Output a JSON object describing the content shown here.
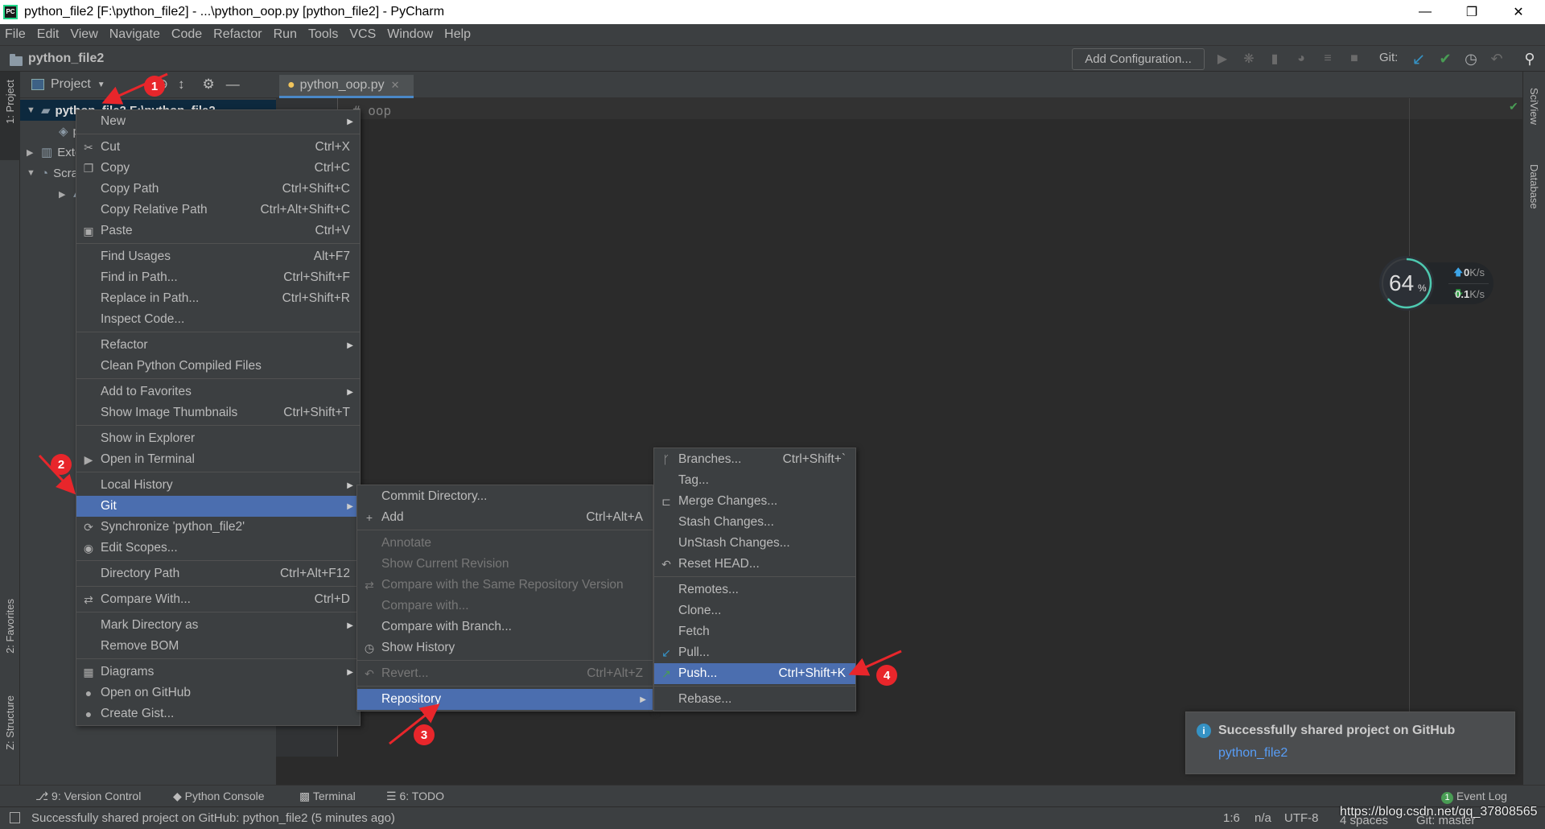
{
  "window": {
    "title": "python_file2 [F:\\python_file2] - ...\\python_oop.py [python_file2] - PyCharm",
    "logo": "PC"
  },
  "menubar": [
    "File",
    "Edit",
    "View",
    "Navigate",
    "Code",
    "Refactor",
    "Run",
    "Tools",
    "VCS",
    "Window",
    "Help"
  ],
  "navbar": {
    "project": "python_file2",
    "add_configuration": "Add Configuration...",
    "git_label": "Git:"
  },
  "left_strip": {
    "project": "1: Project",
    "favorites": "2: Favorites",
    "structure": "Z: Structure"
  },
  "right_strip": {
    "sciview": "SciView",
    "database": "Database"
  },
  "project_panel": {
    "title": "Project",
    "tree": [
      {
        "label": "python_file2  F:\\python_file2",
        "icon": "folder-icon",
        "expanded": true,
        "selected": true
      },
      {
        "label": "python_oop.py",
        "icon": "python-file-icon"
      },
      {
        "label": "External Libraries",
        "icon": "library-icon",
        "expanded": false
      },
      {
        "label": "Scratches and Consoles",
        "icon": "scratches-icon",
        "expanded": true
      },
      {
        "label": "Extensions",
        "icon": "folder-icon",
        "expanded": false
      }
    ]
  },
  "editor": {
    "tab": "python_oop.py",
    "code_line": "# oop"
  },
  "network_widget": {
    "cpu": "64",
    "cpu_unit": "%",
    "upload": "0",
    "download": "0.1",
    "unit": "K/s"
  },
  "context_menu": [
    {
      "label": "New",
      "submenu": true
    },
    {
      "sep": true
    },
    {
      "label": "Cut",
      "shortcut": "Ctrl+X",
      "icon": "cut-icon"
    },
    {
      "label": "Copy",
      "shortcut": "Ctrl+C",
      "icon": "copy-icon"
    },
    {
      "label": "Copy Path",
      "shortcut": "Ctrl+Shift+C"
    },
    {
      "label": "Copy Relative Path",
      "shortcut": "Ctrl+Alt+Shift+C"
    },
    {
      "label": "Paste",
      "shortcut": "Ctrl+V",
      "icon": "paste-icon"
    },
    {
      "sep": true
    },
    {
      "label": "Find Usages",
      "shortcut": "Alt+F7"
    },
    {
      "label": "Find in Path...",
      "shortcut": "Ctrl+Shift+F"
    },
    {
      "label": "Replace in Path...",
      "shortcut": "Ctrl+Shift+R"
    },
    {
      "label": "Inspect Code..."
    },
    {
      "sep": true
    },
    {
      "label": "Refactor",
      "submenu": true
    },
    {
      "label": "Clean Python Compiled Files"
    },
    {
      "sep": true
    },
    {
      "label": "Add to Favorites",
      "submenu": true
    },
    {
      "label": "Show Image Thumbnails",
      "shortcut": "Ctrl+Shift+T"
    },
    {
      "sep": true
    },
    {
      "label": "Show in Explorer"
    },
    {
      "label": "Open in Terminal",
      "icon": "terminal-icon"
    },
    {
      "sep": true
    },
    {
      "label": "Local History",
      "submenu": true
    },
    {
      "label": "Git",
      "submenu": true,
      "highlighted": true
    },
    {
      "label": "Synchronize 'python_file2'",
      "icon": "sync-icon"
    },
    {
      "label": "Edit Scopes...",
      "icon": "scopes-icon"
    },
    {
      "sep": true
    },
    {
      "label": "Directory Path",
      "shortcut": "Ctrl+Alt+F12"
    },
    {
      "sep": true
    },
    {
      "label": "Compare With...",
      "shortcut": "Ctrl+D",
      "icon": "compare-icon"
    },
    {
      "sep": true
    },
    {
      "label": "Mark Directory as",
      "submenu": true
    },
    {
      "label": "Remove BOM"
    },
    {
      "sep": true
    },
    {
      "label": "Diagrams",
      "submenu": true,
      "icon": "diagram-icon"
    },
    {
      "label": "Open on GitHub",
      "icon": "github-icon"
    },
    {
      "label": "Create Gist...",
      "icon": "github-icon"
    }
  ],
  "git_menu": [
    {
      "label": "Commit Directory..."
    },
    {
      "label": "Add",
      "shortcut": "Ctrl+Alt+A",
      "icon": "plus-icon"
    },
    {
      "sep": true
    },
    {
      "label": "Annotate",
      "disabled": true
    },
    {
      "label": "Show Current Revision",
      "disabled": true
    },
    {
      "label": "Compare with the Same Repository Version",
      "disabled": true,
      "icon": "compare-icon"
    },
    {
      "label": "Compare with...",
      "disabled": true
    },
    {
      "label": "Compare with Branch..."
    },
    {
      "label": "Show History",
      "icon": "clock-icon"
    },
    {
      "sep": true
    },
    {
      "label": "Revert...",
      "shortcut": "Ctrl+Alt+Z",
      "disabled": true,
      "icon": "revert-icon"
    },
    {
      "sep": true
    },
    {
      "label": "Repository",
      "submenu": true,
      "highlighted": true
    }
  ],
  "repository_menu": [
    {
      "label": "Branches...",
      "shortcut": "Ctrl+Shift+`",
      "icon": "branch-icon"
    },
    {
      "label": "Tag..."
    },
    {
      "label": "Merge Changes...",
      "icon": "merge-icon"
    },
    {
      "label": "Stash Changes..."
    },
    {
      "label": "UnStash Changes..."
    },
    {
      "label": "Reset HEAD...",
      "icon": "revert-icon"
    },
    {
      "sep": true
    },
    {
      "label": "Remotes..."
    },
    {
      "label": "Clone..."
    },
    {
      "label": "Fetch"
    },
    {
      "label": "Pull...",
      "icon": "pull-icon"
    },
    {
      "label": "Push...",
      "shortcut": "Ctrl+Shift+K",
      "icon": "push-icon",
      "highlighted": true
    },
    {
      "sep": true
    },
    {
      "label": "Rebase..."
    }
  ],
  "annotations": [
    "1",
    "2",
    "3",
    "4"
  ],
  "notification": {
    "title": "Successfully shared project on GitHub",
    "link": "python_file2"
  },
  "bottom_tools": {
    "version_control": "9: Version Control",
    "python_console": "Python Console",
    "terminal": "Terminal",
    "todo": "6: TODO",
    "event_log": "Event Log",
    "event_count": "1"
  },
  "status": {
    "message": "Successfully shared project on GitHub: python_file2 (5 minutes ago)",
    "position": "1:6",
    "na": "n/a",
    "encoding": "UTF-8",
    "indent": "4 spaces",
    "branch": "Git: master",
    "watermark": "https://blog.csdn.net/qq_37808565"
  },
  "colors": {
    "highlight": "#4b6eaf",
    "arrow": "#e8262b",
    "accent_tab": "#4a88c7",
    "link": "#589df6",
    "info": "#3592c4"
  }
}
